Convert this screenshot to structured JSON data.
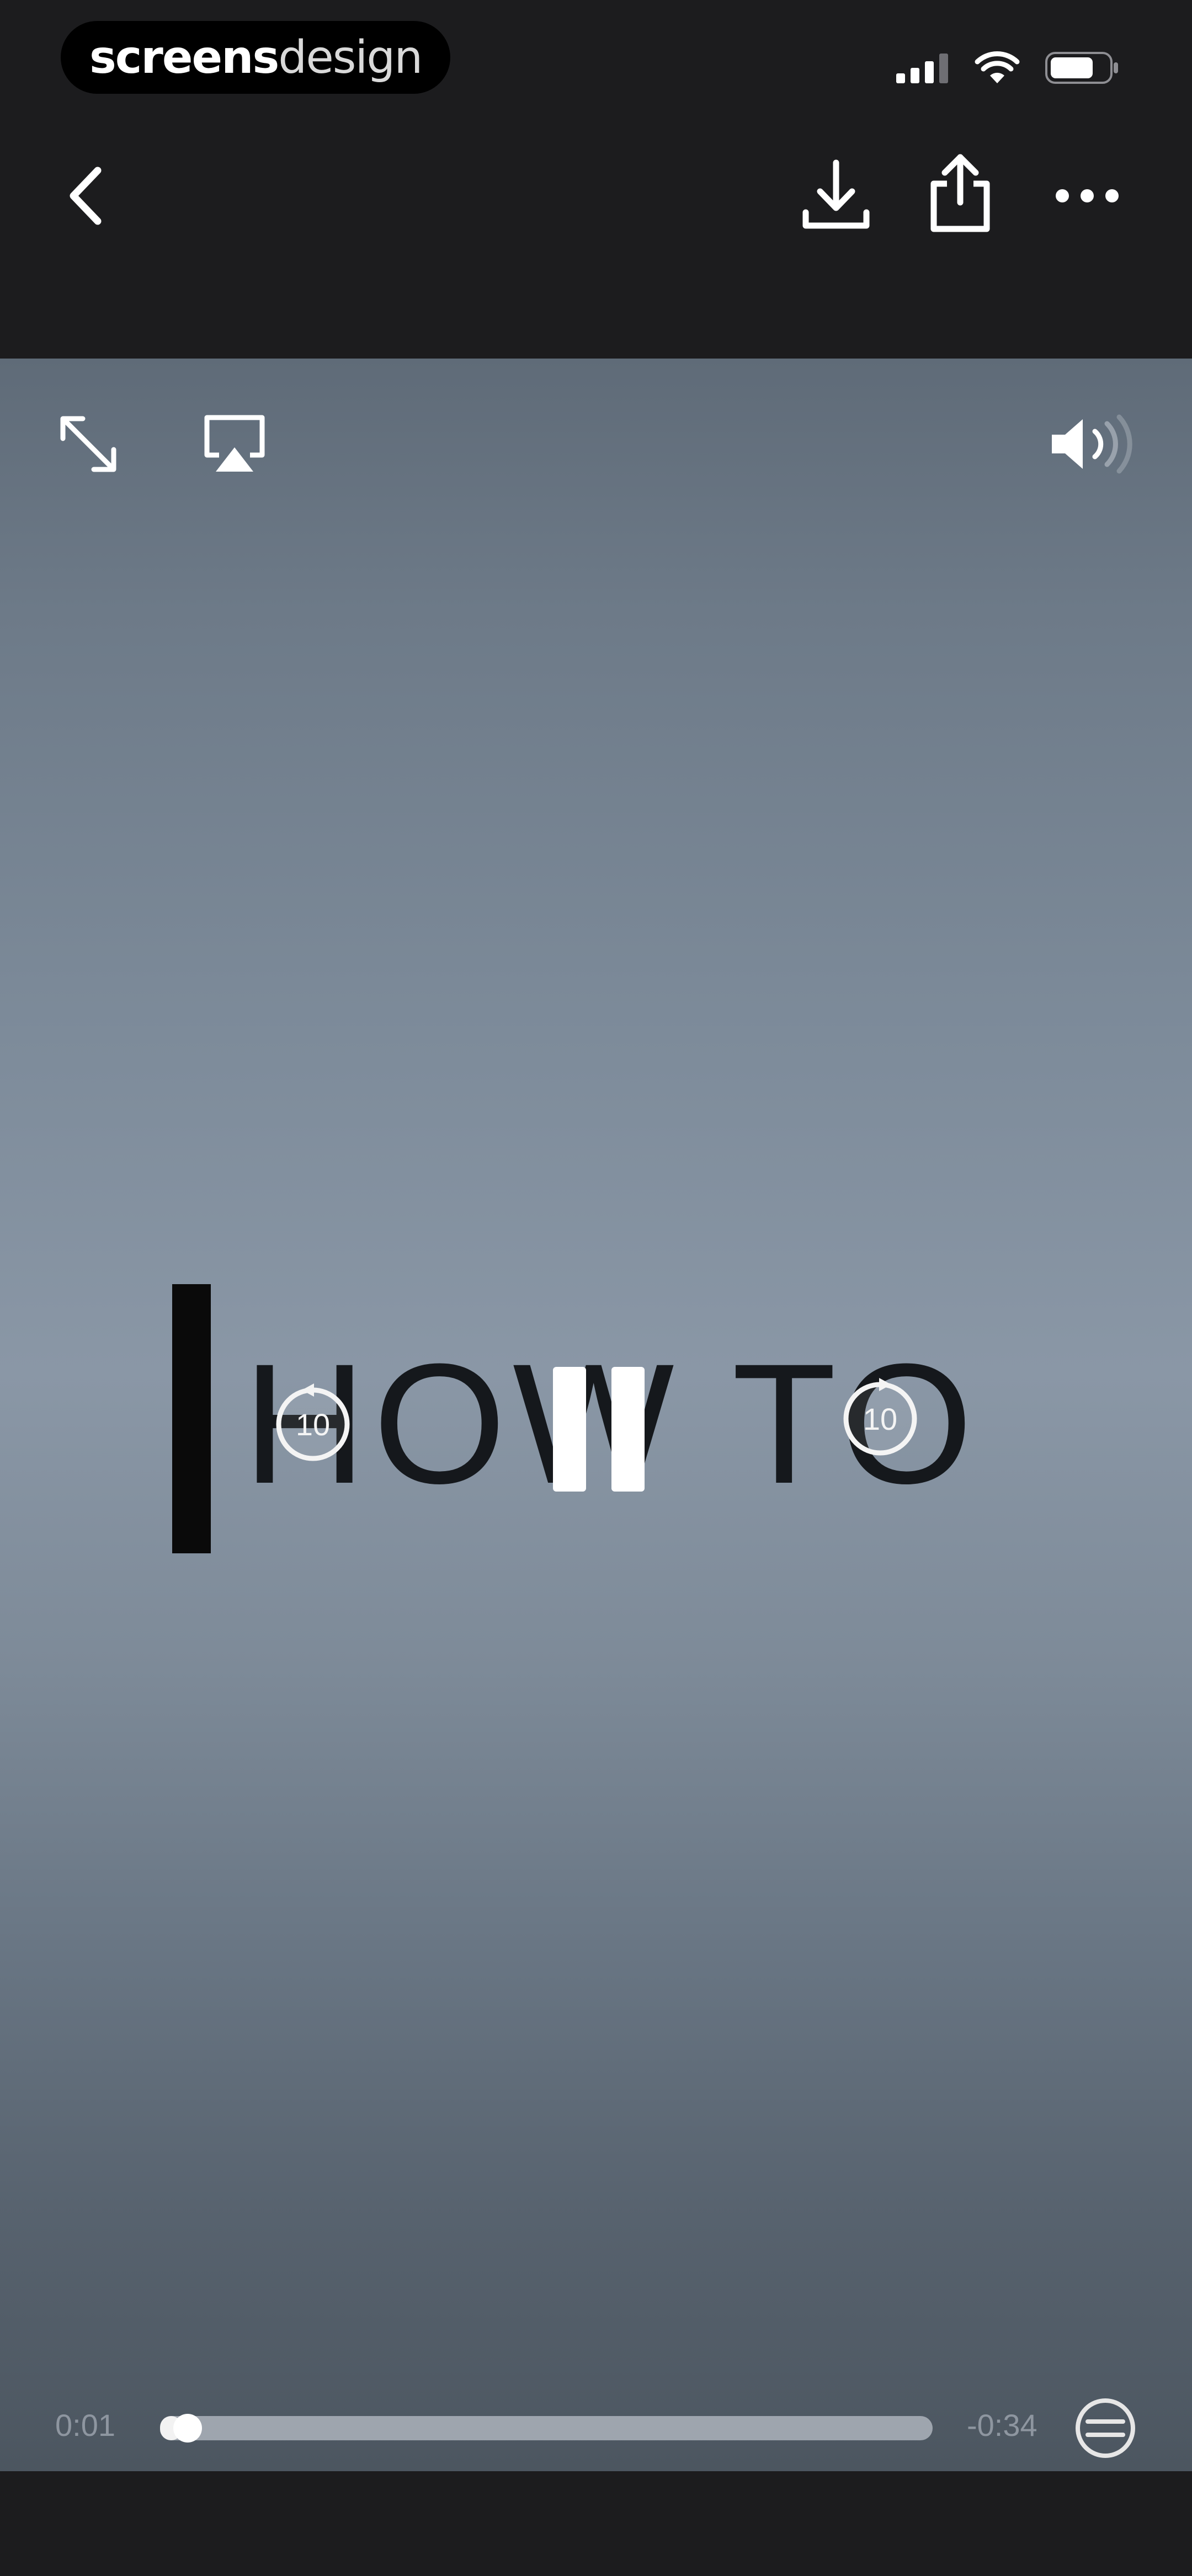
{
  "brand": {
    "bold": "screens",
    "light": "design"
  },
  "status": {
    "signal_icon": "signal-icon",
    "wifi_icon": "wifi-icon",
    "battery_icon": "battery-icon"
  },
  "nav": {
    "back_icon": "chevron-left-icon",
    "download_icon": "download-icon",
    "share_icon": "share-icon",
    "more_icon": "more-horizontal-icon"
  },
  "video": {
    "frame_text": "HOW TO",
    "expand_icon": "expand-icon",
    "airplay_icon": "airplay-icon",
    "volume_icon": "volume-icon",
    "skip_back_label": "10",
    "skip_forward_label": "10",
    "play_state_icon": "pause-icon"
  },
  "playback": {
    "elapsed": "0:01",
    "remaining": "-0:34",
    "progress": 0.02857,
    "speed_icon": "playback-speed-icon"
  },
  "colors": {
    "background": "#1c1c1e",
    "video_mid": "#8a97a6",
    "track": "#9ea5ae",
    "track_fill": "#f2f2f2"
  }
}
